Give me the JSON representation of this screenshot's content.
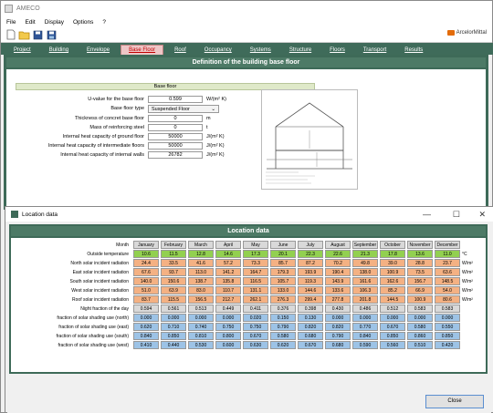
{
  "app": {
    "title": "AMECO",
    "menu": [
      "File",
      "Edit",
      "Display",
      "Options",
      "?"
    ],
    "brand": "ArcelorMittal"
  },
  "tabs": [
    {
      "label": "Project"
    },
    {
      "label": "Building"
    },
    {
      "label": "Envelope"
    },
    {
      "label": "Base Floor"
    },
    {
      "label": "Roof"
    },
    {
      "label": "Occupancy"
    },
    {
      "label": "Systems"
    },
    {
      "label": "Structure"
    },
    {
      "label": "Floors"
    },
    {
      "label": "Transport"
    },
    {
      "label": "Results"
    }
  ],
  "base_floor": {
    "section_title": "Definition of the building base floor",
    "subheader": "Base floor",
    "fields": [
      {
        "label": "U-value for the base floor",
        "value": "0.599",
        "unit": "W/(m² K)"
      },
      {
        "label": "Base floor type",
        "value": "Suspended Floor",
        "unit": ""
      },
      {
        "label": "Thickness of concret base floor",
        "value": "0",
        "unit": "m"
      },
      {
        "label": "Mass of reinforcing steel",
        "value": "0",
        "unit": "t"
      },
      {
        "label": "Internal heat capacity of ground floor",
        "value": "50000",
        "unit": "J/(m² K)"
      },
      {
        "label": "Internal heat capacity of intermediate floors",
        "value": "50000",
        "unit": "J/(m² K)"
      },
      {
        "label": "Internal heat capacity of internal walls",
        "value": "26782",
        "unit": "J/(m² K)"
      }
    ]
  },
  "location": {
    "window_title": "Location data",
    "section_title": "Location data",
    "month_label": "Month",
    "months": [
      "January",
      "February",
      "March",
      "April",
      "May",
      "June",
      "July",
      "August",
      "September",
      "October",
      "November",
      "December"
    ],
    "rows": [
      {
        "label": "Outside temperature",
        "unit": "°C",
        "color": "#92d050",
        "values": [
          "10.6",
          "11.5",
          "12.8",
          "14.6",
          "17.3",
          "20.1",
          "22.3",
          "22.6",
          "21.3",
          "17.8",
          "13.6",
          "11.0"
        ]
      },
      {
        "label": "North solar incident radiation",
        "unit": "W/m²",
        "color": "#f4b183",
        "values": [
          "24.4",
          "33.5",
          "41.6",
          "57.2",
          "73.3",
          "85.7",
          "87.2",
          "70.2",
          "49.8",
          "39.0",
          "28.8",
          "23.7"
        ]
      },
      {
        "label": "East solar incident radiation",
        "unit": "W/m²",
        "color": "#f4b183",
        "values": [
          "67.6",
          "93.7",
          "113.0",
          "141.2",
          "164.7",
          "179.3",
          "193.9",
          "190.4",
          "138.0",
          "100.9",
          "73.5",
          "63.6"
        ]
      },
      {
        "label": "South solar incident radiation",
        "unit": "W/m²",
        "color": "#f4b183",
        "values": [
          "140.0",
          "150.6",
          "138.7",
          "135.8",
          "116.5",
          "105.7",
          "119.3",
          "143.9",
          "161.6",
          "162.6",
          "156.7",
          "148.5"
        ]
      },
      {
        "label": "West solar incident radiation",
        "unit": "W/m²",
        "color": "#f4b183",
        "values": [
          "51.0",
          "63.9",
          "83.0",
          "110.7",
          "131.1",
          "133.0",
          "144.6",
          "133.6",
          "106.3",
          "85.2",
          "66.9",
          "54.0"
        ]
      },
      {
        "label": "Roof solar incident radiation",
        "unit": "W/m²",
        "color": "#f4b183",
        "values": [
          "83.7",
          "115.5",
          "156.5",
          "212.7",
          "262.1",
          "276.3",
          "299.4",
          "277.8",
          "201.8",
          "144.5",
          "100.9",
          "80.6"
        ]
      },
      {
        "label": "Night fraction of the day",
        "unit": "",
        "color": "#d9d9d9",
        "values": [
          "0.594",
          "0.561",
          "0.513",
          "0.449",
          "0.411",
          "0.376",
          "0.398",
          "0.430",
          "0.486",
          "0.512",
          "0.583",
          "0.583"
        ]
      },
      {
        "label": "fraction of solar shading use (north)",
        "unit": "",
        "color": "#9dc3e6",
        "values": [
          "0.000",
          "0.000",
          "0.000",
          "0.000",
          "0.020",
          "0.150",
          "0.130",
          "0.000",
          "0.000",
          "0.000",
          "0.000",
          "0.000"
        ]
      },
      {
        "label": "fraction of solar shading use (east)",
        "unit": "",
        "color": "#9dc3e6",
        "values": [
          "0.620",
          "0.710",
          "0.740",
          "0.750",
          "0.750",
          "0.790",
          "0.820",
          "0.820",
          "0.770",
          "0.670",
          "0.580",
          "0.550"
        ]
      },
      {
        "label": "fraction of solar shading use (south)",
        "unit": "",
        "color": "#9dc3e6",
        "values": [
          "0.840",
          "0.850",
          "0.810",
          "0.800",
          "0.670",
          "0.580",
          "0.680",
          "0.790",
          "0.840",
          "0.850",
          "0.860",
          "0.850"
        ]
      },
      {
        "label": "fraction of solar shading use (west)",
        "unit": "",
        "color": "#9dc3e6",
        "values": [
          "0.410",
          "0.440",
          "0.530",
          "0.600",
          "0.630",
          "0.620",
          "0.670",
          "0.680",
          "0.590",
          "0.560",
          "0.510",
          "0.420"
        ]
      }
    ],
    "close_label": "Close"
  }
}
